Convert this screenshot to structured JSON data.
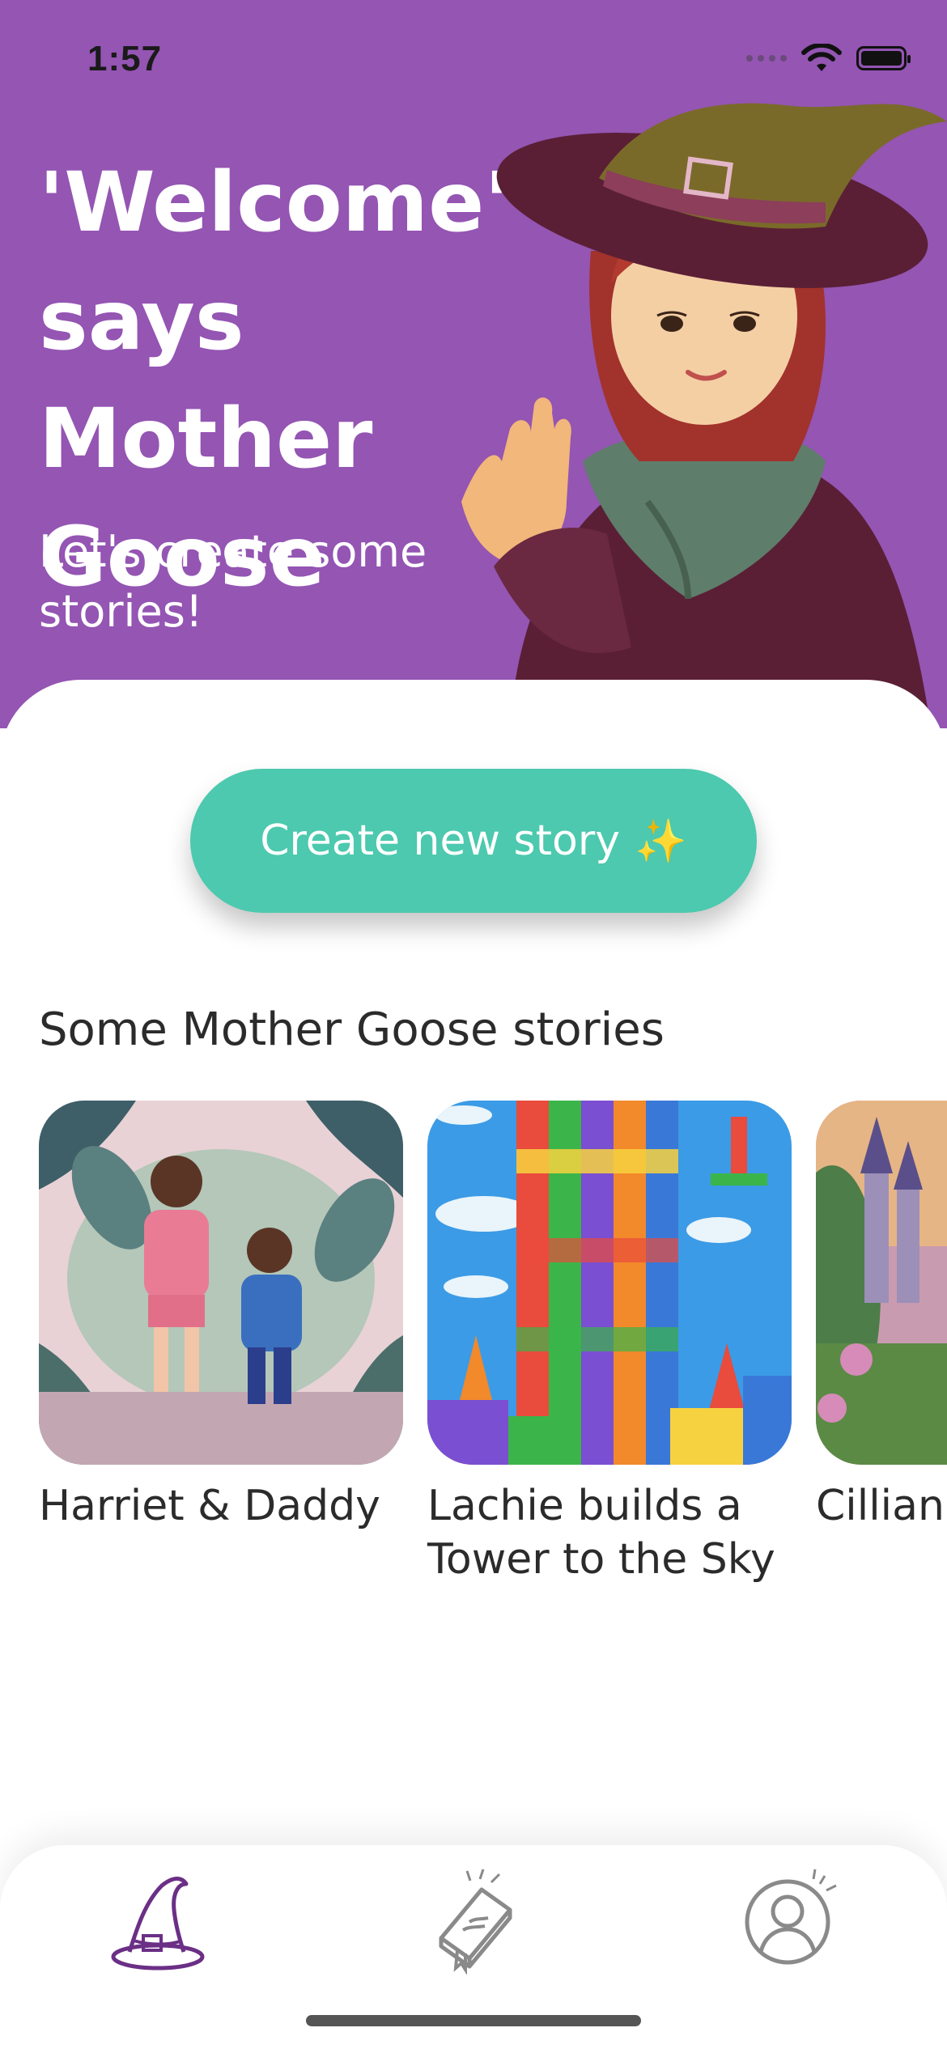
{
  "status_bar": {
    "time": "1:57"
  },
  "hero": {
    "title": "'Welcome' says Mother Goose",
    "subtitle": "Let's create some stories!"
  },
  "create_button": {
    "label": "Create new story",
    "emoji": "✨"
  },
  "stories_section": {
    "title": "Some Mother Goose stories",
    "items": [
      {
        "title": "Harriet & Daddy"
      },
      {
        "title": "Lachie builds a Tower to the Sky"
      },
      {
        "title": "Cillian & Magic"
      }
    ]
  },
  "tab_bar": {
    "tabs": [
      {
        "icon": "witch-hat-icon",
        "active": true
      },
      {
        "icon": "book-icon",
        "active": false
      },
      {
        "icon": "profile-icon",
        "active": false
      }
    ]
  },
  "colors": {
    "hero_bg": "#9455b3",
    "accent": "#4cc9ae",
    "active_icon": "#6b2f86",
    "inactive_icon": "#8a8a8a"
  }
}
